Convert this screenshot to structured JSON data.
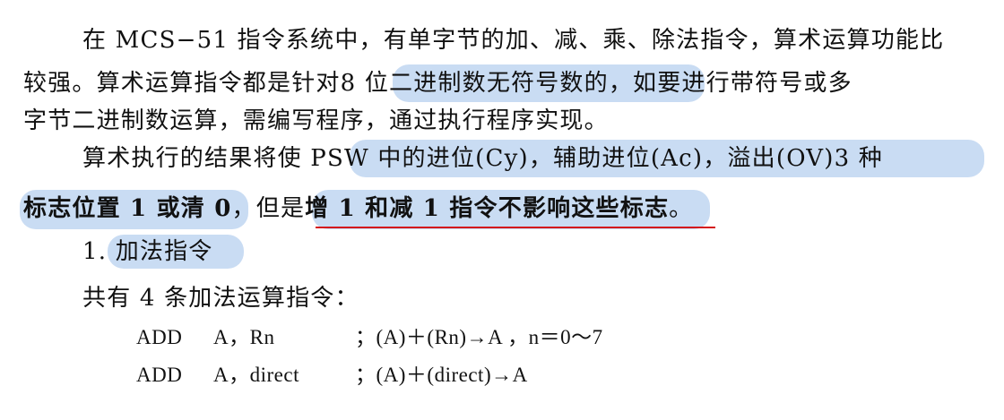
{
  "paragraph1": {
    "line1": "在 MCS−51 指令系统中，有单字节的加、减、乘、除法指令，算术运算功能比",
    "line2_before": "较强。算术运算指令都是针对",
    "line2_highlight": "8 位二进制数无符号数",
    "line2_after": "的，如要进行带符号或多",
    "line3": "字节二进制数运算，需编写程序，通过执行程序实现。"
  },
  "paragraph2": {
    "line4_before": "算术执行的结果将使 ",
    "line4_highlight": "PSW 中的进位(Cy)，辅助进位(Ac)，溢出(OV)3 种",
    "line5_highlight": "标志位置 1 或清 0",
    "line5_middle": "，但是",
    "line5_underlined": "增 1 和减 1 指令不影响这些标志",
    "line5_end": "。"
  },
  "section": {
    "number": "1.",
    "title": "加法指令"
  },
  "intro": "共有 4 条加法运算指令：",
  "instructions": [
    {
      "mnemonic": "ADD",
      "operands": "A，Rn",
      "comment": "；(A)＋(Rn)→A ，n＝0～7"
    },
    {
      "mnemonic": "ADD",
      "operands": "A，direct",
      "comment": "；(A)＋(direct)→A"
    }
  ],
  "highlight_color": "#c9dcf3",
  "underline_color": "#d4151b"
}
